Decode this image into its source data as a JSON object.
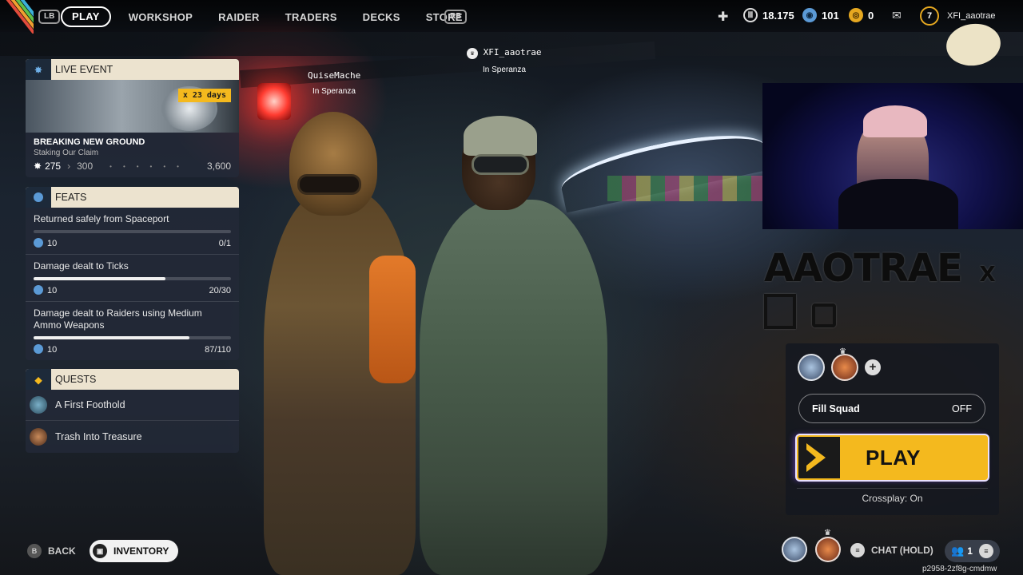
{
  "topbar": {
    "lb": "LB",
    "rb": "RB",
    "nav": [
      "PLAY",
      "WORKSHOP",
      "RAIDER",
      "TRADERS",
      "DECKS",
      "STORE"
    ],
    "currency_1": "18.175",
    "currency_2": "101",
    "currency_3": "0",
    "level": "7",
    "username": "XFI_aaotrae"
  },
  "players": [
    {
      "name": "QuiseMache",
      "location": "In Speranza"
    },
    {
      "name": "XFI_aaotrae",
      "location": "In Speranza"
    }
  ],
  "live_event": {
    "header": "LIVE EVENT",
    "days_badge": "x 23 days",
    "title": "BREAKING NEW GROUND",
    "subtitle": "Staking Our Claim",
    "progress_current": "275",
    "progress_next": "300",
    "progress_max": "3,600"
  },
  "feats": {
    "header": "FEATS",
    "items": [
      {
        "title": "Returned safely from Spaceport",
        "reward": "10",
        "progress": "0/1",
        "fraction": 0.0
      },
      {
        "title": "Damage dealt to Ticks",
        "reward": "10",
        "progress": "20/30",
        "fraction": 0.667
      },
      {
        "title": "Damage dealt to Raiders using Medium Ammo Weapons",
        "reward": "10",
        "progress": "87/110",
        "fraction": 0.79
      }
    ]
  },
  "quests": {
    "header": "QUESTS",
    "items": [
      "A First Foothold",
      "Trash Into Treasure"
    ]
  },
  "stream_brand": {
    "name": "AAOTRAE",
    "x": "X"
  },
  "squad": {
    "fill_squad_label": "Fill Squad",
    "fill_squad_value": "OFF",
    "play_label": "PLAY",
    "crossplay": "Crossplay: On"
  },
  "bottom": {
    "back_glyph": "B",
    "back_label": "BACK",
    "inventory_label": "INVENTORY",
    "chat_label": "CHAT (HOLD)",
    "party_count": "1",
    "session_id": "p2958-2zf8g-cmdmw"
  },
  "colors": {
    "accent_yellow": "#f4b91e",
    "panel_header": "#ece3cf",
    "feat_blue": "#5b9ad6"
  }
}
